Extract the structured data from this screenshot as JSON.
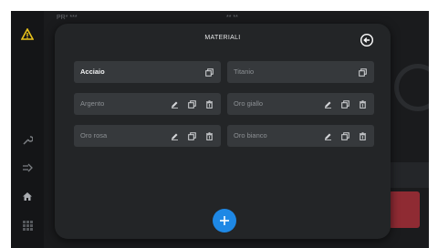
{
  "background": {
    "header_left": "PR* ***",
    "header_center": "** **",
    "accent_color": "#1e88e5",
    "danger_color": "#8f2b33"
  },
  "sidebar": {
    "icons": [
      "warning-icon",
      "wrench-icon",
      "export-icon",
      "home-icon",
      "grid-icon"
    ]
  },
  "modal": {
    "title": "MATERIALI",
    "back_icon": "back-arrow-icon",
    "materials": [
      {
        "label": "Acciaio",
        "selected": true,
        "actions": [
          "copy"
        ]
      },
      {
        "label": "Titanio",
        "selected": false,
        "actions": [
          "copy"
        ]
      },
      {
        "label": "Argento",
        "selected": false,
        "actions": [
          "edit",
          "copy",
          "delete"
        ]
      },
      {
        "label": "Oro giallo",
        "selected": false,
        "actions": [
          "edit",
          "copy",
          "delete"
        ]
      },
      {
        "label": "Oro rosa",
        "selected": false,
        "actions": [
          "edit",
          "copy",
          "delete"
        ]
      },
      {
        "label": "Oro bianco",
        "selected": false,
        "actions": [
          "edit",
          "copy",
          "delete"
        ]
      }
    ],
    "add_icon": "plus-icon"
  }
}
